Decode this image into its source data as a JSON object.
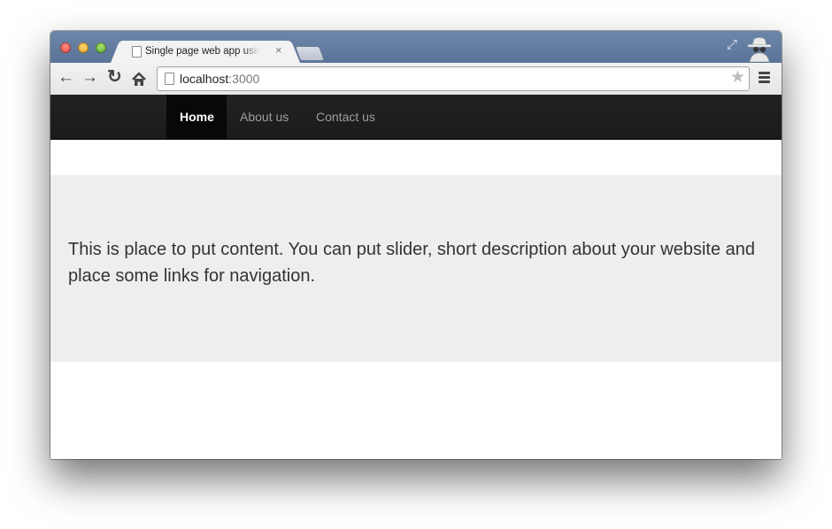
{
  "browser": {
    "tab": {
      "title": "Single page web app using",
      "close_glyph": "×"
    },
    "address_bar": {
      "host": "localhost",
      "port": ":3000"
    },
    "icons": [
      "back-arrow-icon",
      "forward-arrow-icon",
      "reload-icon",
      "home-icon",
      "page-icon",
      "star-icon",
      "menu-icon",
      "fullscreen-icon",
      "incognito-icon"
    ]
  },
  "navbar": {
    "items": [
      {
        "label": "Home",
        "active": true
      },
      {
        "label": "About us",
        "active": false
      },
      {
        "label": "Contact us",
        "active": false
      }
    ]
  },
  "jumbotron": {
    "text": "This is place to put content. You can put slider, short description about your website and place some links for navigation."
  },
  "colors": {
    "navbar_bg": "#222222",
    "active_nav_bg": "#080808",
    "jumbotron_bg": "#eeeeee",
    "tabstrip": "#5a7398"
  }
}
